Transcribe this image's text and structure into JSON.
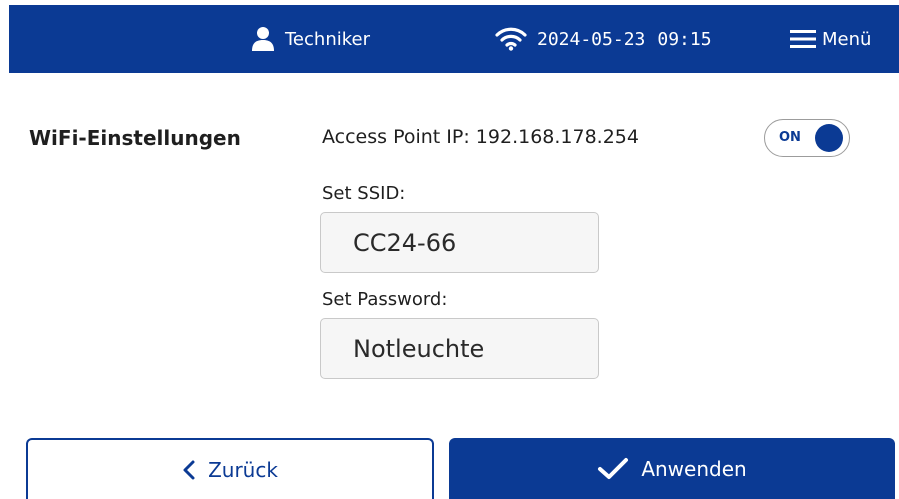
{
  "header": {
    "user_label": "Techniker",
    "date": "2024-05-23",
    "time": "09:15",
    "menu_label": "Menü",
    "icons": {
      "user": "user-icon",
      "wifi": "wifi-icon",
      "menu": "hamburger-menu-icon"
    }
  },
  "wifi_settings": {
    "title": "WiFi-Einstellungen",
    "access_point_ip_text": "Access Point IP: 192.168.178.254",
    "toggle": {
      "label": "ON",
      "state": true
    },
    "ssid": {
      "label": "Set SSID:",
      "value": "CC24-66"
    },
    "password": {
      "label": "Set Password:",
      "value": "Notleuchte"
    }
  },
  "footer": {
    "back_label": "Zurück",
    "apply_label": "Anwenden",
    "icons": {
      "back": "chevron-left-icon",
      "apply": "checkmark-icon"
    }
  },
  "colors": {
    "primary": "#0b3a94",
    "background": "#ffffff",
    "field_background": "#f6f6f6",
    "field_border": "#c9c9c9",
    "text": "#1f1f1f"
  }
}
